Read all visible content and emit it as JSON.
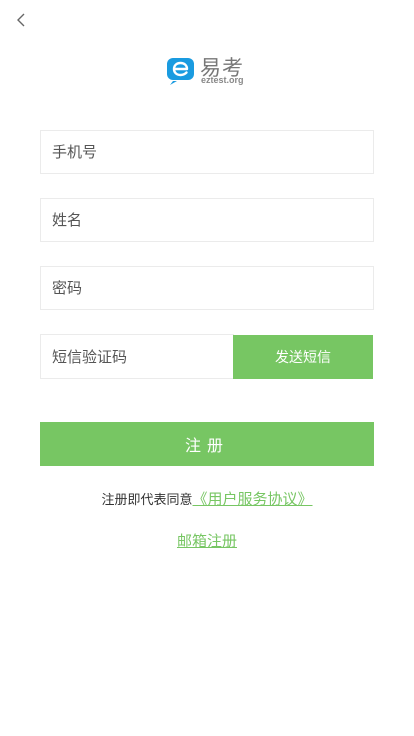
{
  "header": {
    "back_icon": "chevron-left-icon"
  },
  "logo": {
    "brand_cn": "易考",
    "brand_en": "eztest.org",
    "mark_icon": "eztest-logo-icon",
    "brand_color": "#1a9be0"
  },
  "form": {
    "phone": {
      "placeholder": "手机号",
      "value": ""
    },
    "name": {
      "placeholder": "姓名",
      "value": ""
    },
    "password": {
      "placeholder": "密码",
      "value": ""
    },
    "sms_code": {
      "placeholder": "短信验证码",
      "value": ""
    },
    "send_sms_label": "发送短信",
    "register_label": "注册"
  },
  "agreement": {
    "prefix": "注册即代表同意",
    "link_label": "《用户服务协议》"
  },
  "email_register_label": "邮箱注册",
  "colors": {
    "accent": "#77c663",
    "border": "#ebebeb",
    "text": "#333333"
  }
}
